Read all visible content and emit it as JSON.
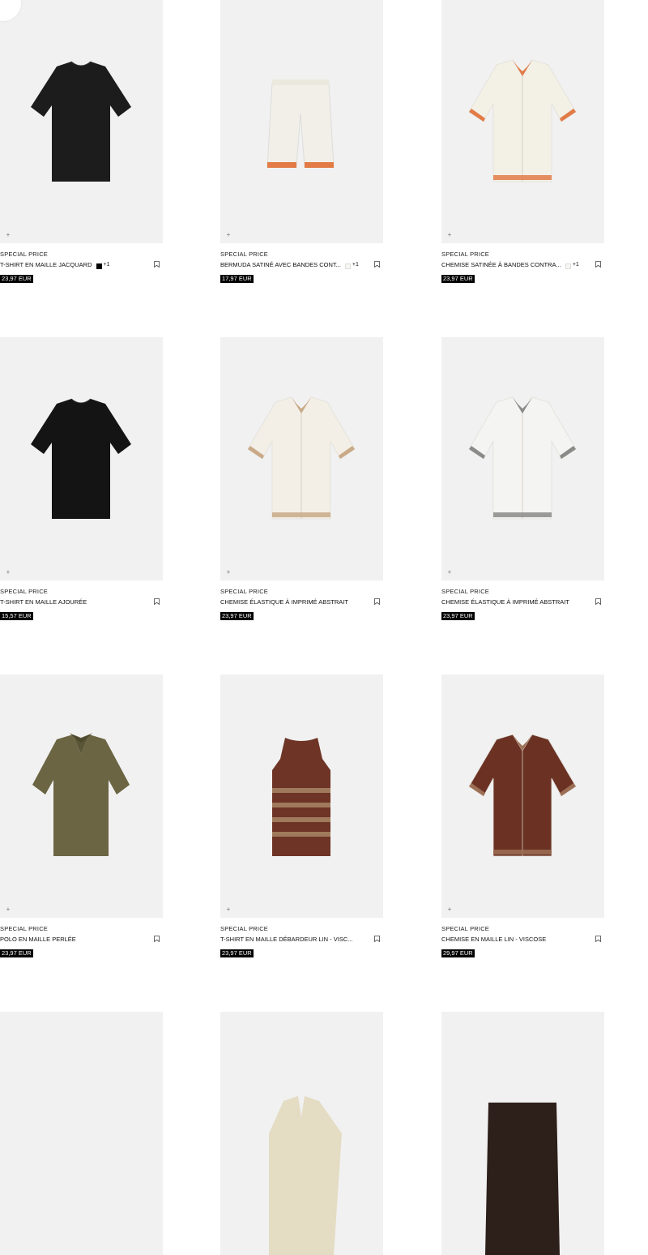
{
  "products": [
    {
      "promo": "SPECIAL PRICE",
      "name": "T-SHIRT EN MAILLE JACQUARD",
      "swatch": "dark",
      "more": "+1",
      "price": "23,97 EUR",
      "garment": "tee",
      "color": "#1c1c1c",
      "accent": "#1c1c1c",
      "add": "+"
    },
    {
      "promo": "SPECIAL PRICE",
      "name": "BERMUDA SATINÉ AVEC BANDES CONT...",
      "swatch": "light",
      "more": "+1",
      "price": "17,97 EUR",
      "garment": "shorts",
      "color": "#f1efe7",
      "accent": "#e27b46",
      "add": "+"
    },
    {
      "promo": "SPECIAL PRICE",
      "name": "CHEMISE SATINÉE À BANDES CONTRA...",
      "swatch": "light",
      "more": "+1",
      "price": "23,97 EUR",
      "garment": "shirt",
      "color": "#f3f0e6",
      "accent": "#e27b46",
      "add": "+"
    },
    {
      "promo": "SPECIAL PRICE",
      "name": "T-SHIRT EN MAILLE AJOURÉE",
      "swatch": "",
      "more": "",
      "price": "15,57 EUR",
      "garment": "tee",
      "color": "#141414",
      "accent": "#141414",
      "add": "+"
    },
    {
      "promo": "SPECIAL PRICE",
      "name": "CHEMISE ÉLASTIQUE À IMPRIMÉ ABSTRAIT",
      "swatch": "",
      "more": "",
      "price": "23,97 EUR",
      "garment": "shirt",
      "color": "#f3efe6",
      "accent": "#c9a987",
      "add": "+"
    },
    {
      "promo": "SPECIAL PRICE",
      "name": "CHEMISE ÉLASTIQUE À IMPRIMÉ ABSTRAIT",
      "swatch": "",
      "more": "",
      "price": "23,97 EUR",
      "garment": "shirt",
      "color": "#f4f4f2",
      "accent": "#8a8a88",
      "add": "+"
    },
    {
      "promo": "SPECIAL PRICE",
      "name": "POLO EN MAILLE PERLÉE",
      "swatch": "",
      "more": "",
      "price": "23,97 EUR",
      "garment": "polo",
      "color": "#6b6543",
      "accent": "#5a5536",
      "add": "+"
    },
    {
      "promo": "SPECIAL PRICE",
      "name": "T-SHIRT EN MAILLE DÉBARDEUR LIN - VISC...",
      "swatch": "",
      "more": "",
      "price": "23,97 EUR",
      "garment": "tank",
      "color": "#6e3426",
      "accent": "#a07a5c",
      "add": "+"
    },
    {
      "promo": "SPECIAL PRICE",
      "name": "CHEMISE EN MAILLE LIN - VISCOSE",
      "swatch": "",
      "more": "",
      "price": "29,97 EUR",
      "garment": "shirt",
      "color": "#6b3224",
      "accent": "#9c6f55",
      "add": "+"
    },
    {
      "garment": "none",
      "color": "#f1f1f1"
    },
    {
      "garment": "polo-top",
      "color": "#e4dcc3"
    },
    {
      "garment": "shorts-top",
      "color": "#2d1f1a"
    }
  ]
}
